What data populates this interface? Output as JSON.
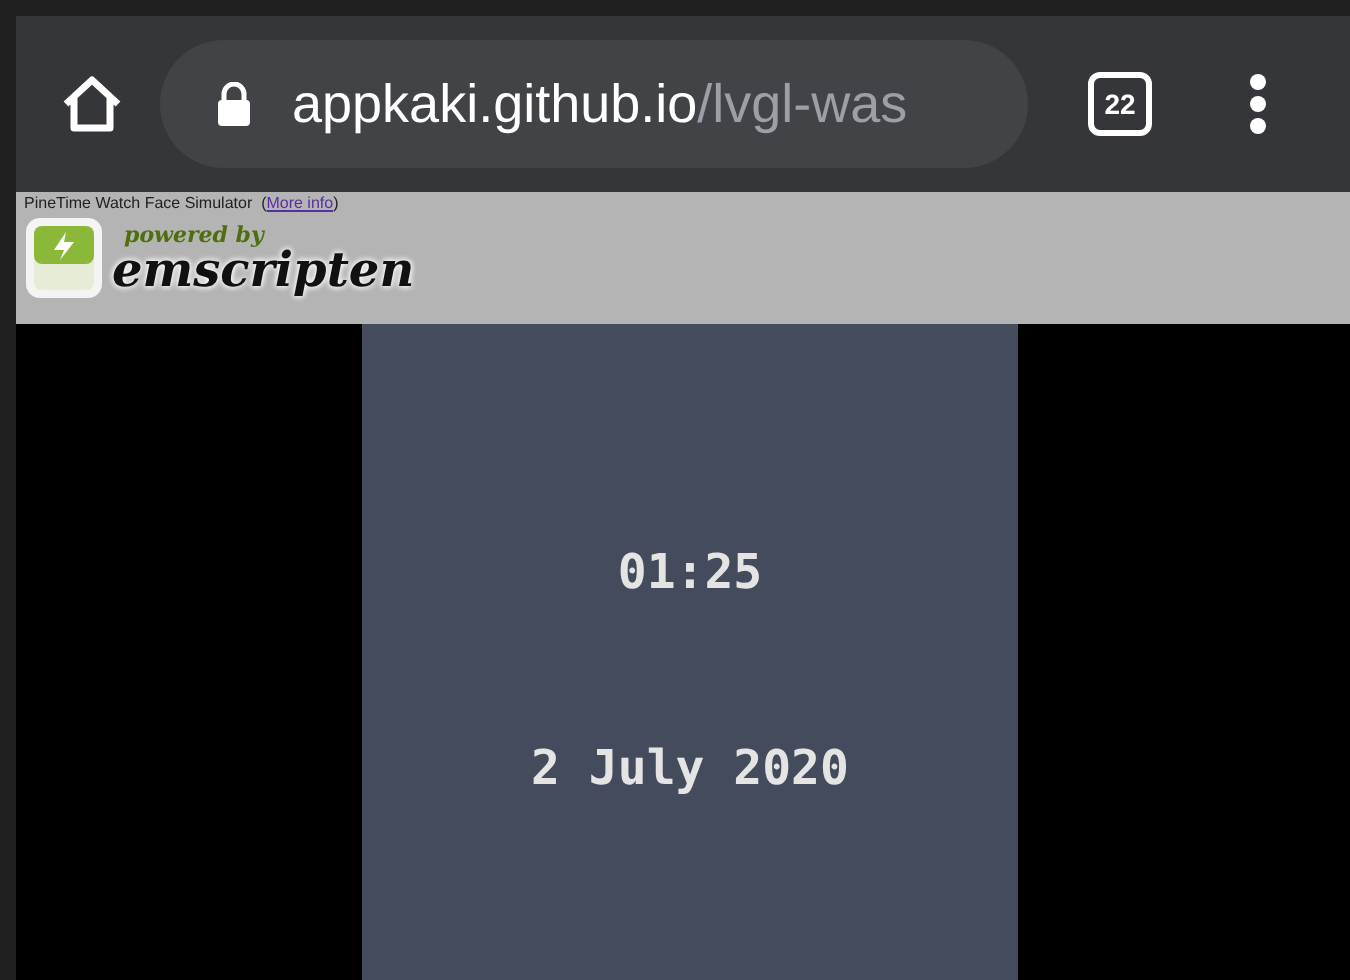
{
  "toolbar": {
    "url_host": "appkaki.github.io",
    "url_path": "/lvgl-was",
    "tab_count": "22"
  },
  "page": {
    "title": "PineTime Watch Face Simulator",
    "link_open": "(",
    "link": "More info",
    "link_close": ")",
    "logo": {
      "tagline": "powered by",
      "name": "emscripten"
    }
  },
  "watch": {
    "time": "01:25",
    "date": "2 July 2020"
  }
}
